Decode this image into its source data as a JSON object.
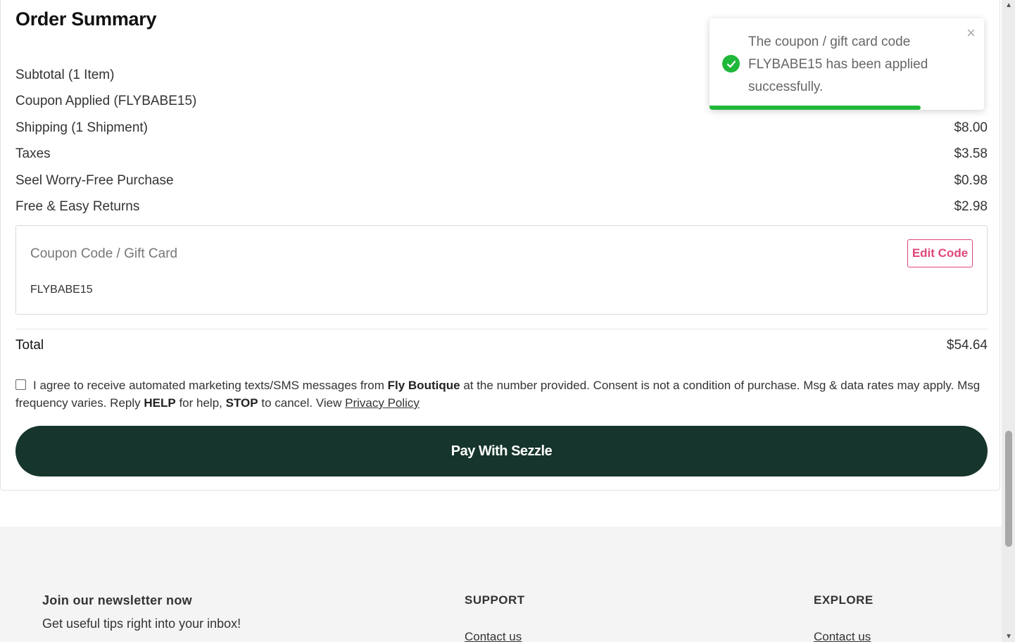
{
  "summary": {
    "title": "Order Summary",
    "rows": [
      {
        "label": "Subtotal (1 Item)",
        "value": ""
      },
      {
        "label": "Coupon Applied (FLYBABE15)",
        "value": ""
      },
      {
        "label": "Shipping (1 Shipment)",
        "value": "$8.00"
      },
      {
        "label": "Taxes",
        "value": "$3.58"
      },
      {
        "label": "Seel Worry-Free Purchase",
        "value": "$0.98"
      },
      {
        "label": "Free & Easy Returns",
        "value": "$2.98"
      }
    ],
    "coupon": {
      "label": "Coupon Code / Gift Card",
      "value": "FLYBABE15",
      "edit_label": "Edit Code"
    },
    "total": {
      "label": "Total",
      "value": "$54.64"
    }
  },
  "consent": {
    "prefix": "I agree to receive automated marketing texts/SMS messages from",
    "brand": "Fly Boutique",
    "middle": "at the number provided. Consent is not a condition of purchase. Msg & data rates may apply. Msg frequency varies. Reply",
    "help": "HELP",
    "for_help": "for help,",
    "stop": "STOP",
    "to_cancel": "to cancel. View",
    "privacy": "Privacy Policy"
  },
  "pay_button": "Pay With Sezzle",
  "toast": {
    "message": "The coupon / gift card code FLYBABE15 has been applied successfully.",
    "close": "×",
    "progress": 0.77,
    "color": "#1fb83a"
  },
  "footer": {
    "newsletter_title": "Join our newsletter now",
    "newsletter_sub": "Get useful tips right into your inbox!",
    "support_title": "SUPPORT",
    "support_link": "Contact us",
    "explore_title": "EXPLORE",
    "explore_link": "Contact us"
  },
  "colors": {
    "pay_button": "#16352c",
    "edit_accent": "#e0467c"
  }
}
